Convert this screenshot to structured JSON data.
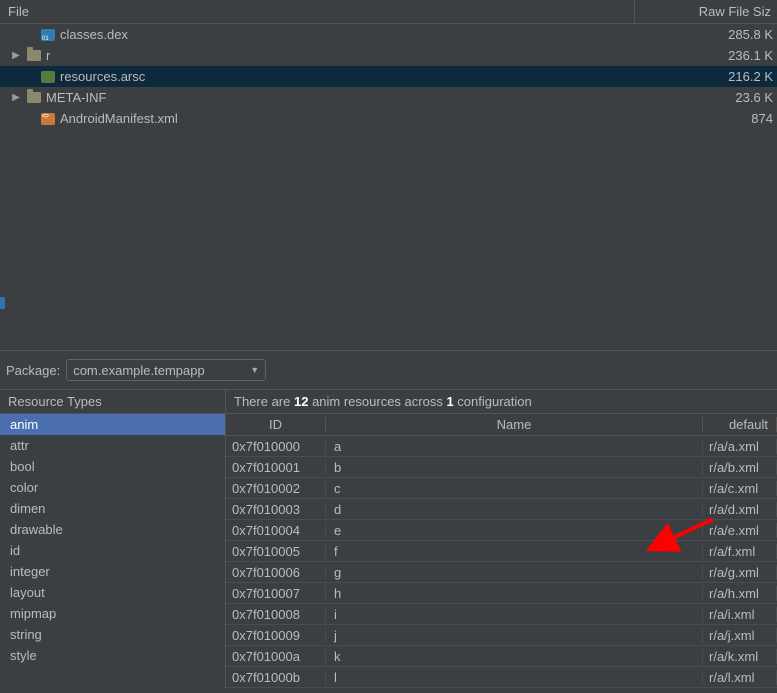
{
  "top": {
    "header": {
      "file": "File",
      "size": "Raw File Siz"
    },
    "rows": [
      {
        "indent": 24,
        "arrow": false,
        "icon": "dex",
        "label": "classes.dex",
        "size": "285.8 K"
      },
      {
        "indent": 10,
        "arrow": true,
        "icon": "folder",
        "label": "r",
        "size": "236.1 K"
      },
      {
        "indent": 24,
        "arrow": false,
        "icon": "arsc",
        "label": "resources.arsc",
        "size": "216.2 K",
        "selected": true
      },
      {
        "indent": 10,
        "arrow": true,
        "icon": "folder",
        "label": "META-INF",
        "size": "23.6 K"
      },
      {
        "indent": 24,
        "arrow": false,
        "icon": "xml",
        "label": "AndroidManifest.xml",
        "size": "874 "
      }
    ]
  },
  "package": {
    "label": "Package:",
    "value": "com.example.tempapp"
  },
  "resource_types": {
    "header": "Resource Types",
    "items": [
      "anim",
      "attr",
      "bool",
      "color",
      "dimen",
      "drawable",
      "id",
      "integer",
      "layout",
      "mipmap",
      "string",
      "style"
    ],
    "selected": 0
  },
  "resources": {
    "summary": {
      "pre": "There are ",
      "count": "12",
      "mid": " anim resources across ",
      "cfg": "1",
      "post": " configuration"
    },
    "columns": {
      "id": "ID",
      "name": "Name",
      "def": "default"
    },
    "rows": [
      {
        "id": "0x7f010000",
        "name": "a",
        "def": "r/a/a.xml"
      },
      {
        "id": "0x7f010001",
        "name": "b",
        "def": "r/a/b.xml"
      },
      {
        "id": "0x7f010002",
        "name": "c",
        "def": "r/a/c.xml"
      },
      {
        "id": "0x7f010003",
        "name": "d",
        "def": "r/a/d.xml"
      },
      {
        "id": "0x7f010004",
        "name": "e",
        "def": "r/a/e.xml"
      },
      {
        "id": "0x7f010005",
        "name": "f",
        "def": "r/a/f.xml"
      },
      {
        "id": "0x7f010006",
        "name": "g",
        "def": "r/a/g.xml"
      },
      {
        "id": "0x7f010007",
        "name": "h",
        "def": "r/a/h.xml"
      },
      {
        "id": "0x7f010008",
        "name": "i",
        "def": "r/a/i.xml"
      },
      {
        "id": "0x7f010009",
        "name": "j",
        "def": "r/a/j.xml"
      },
      {
        "id": "0x7f01000a",
        "name": "k",
        "def": "r/a/k.xml"
      },
      {
        "id": "0x7f01000b",
        "name": "l",
        "def": "r/a/l.xml"
      }
    ]
  }
}
